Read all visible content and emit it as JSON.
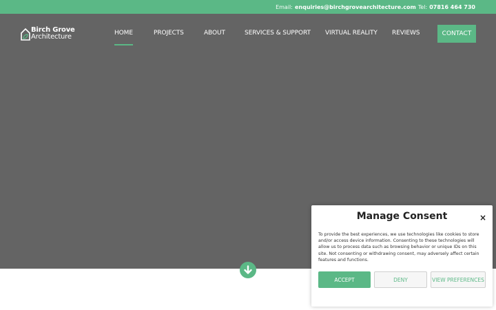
{
  "colors": {
    "brand": "#5bb886",
    "hero_bg": "#646464"
  },
  "topbar": {
    "email_label": "Email:",
    "email": "enquiries@birchgrovearchitecture.com",
    "tel_label": "Tel:",
    "tel": "07816 464 730"
  },
  "logo": {
    "line1": "Birch Grove",
    "line2": "Architecture",
    "icon": "house-leaf-icon"
  },
  "nav": {
    "items": [
      {
        "label": "HOME"
      },
      {
        "label": "PROJECTS"
      },
      {
        "label": "ABOUT"
      },
      {
        "label": "SERVICES & SUPPORT"
      },
      {
        "label": "VIRTUAL REALITY"
      },
      {
        "label": "REVIEWS"
      }
    ],
    "contact": "CONTACT"
  },
  "hero": {
    "scroll_icon": "arrow-down-circle-icon"
  },
  "consent": {
    "title": "Manage Consent",
    "close": "×",
    "body": "To provide the best experiences, we use technologies like cookies to store and/or access device information. Consenting to these technologies will allow us to process data such as browsing behavior or unique IDs on this site. Not consenting or withdrawing consent, may adversely affect certain features and functions.",
    "accept": "ACCEPT",
    "deny": "DENY",
    "preferences": "VIEW PREFERENCES"
  }
}
